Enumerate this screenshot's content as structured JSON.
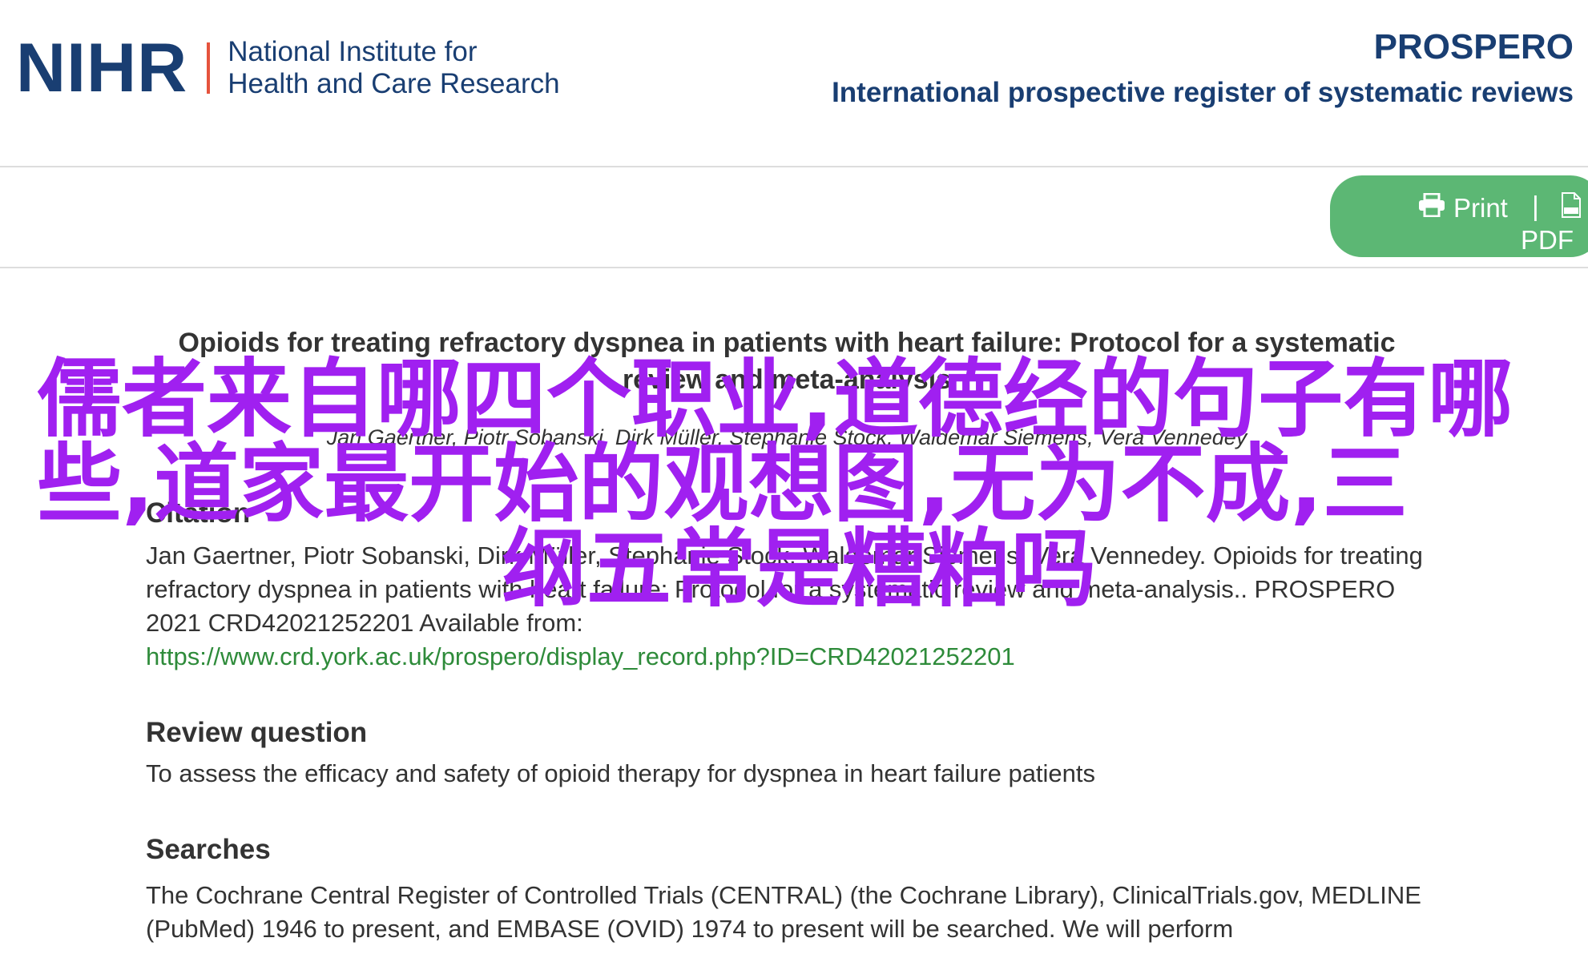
{
  "header": {
    "org_mark": "NIHR",
    "org_line1": "National Institute for",
    "org_line2": "Health and Care Research",
    "site_title": "PROSPERO",
    "site_subtitle": "International prospective register of systematic reviews"
  },
  "toolbar": {
    "print_label": "Print",
    "separator": "|",
    "pdf_label": "PDF",
    "pill_color": "#5cb774"
  },
  "record": {
    "title_line1": "Opioids for treating refractory dyspnea in patients with heart failure: Protocol for a systematic",
    "title_line2": "review and meta-analysis",
    "authors": "Jan Gaertner, Piotr Sobanski, Dirk Müller, Stephanie Stock, Waldemar Siemens, Vera Vennedey",
    "citation_heading": "Citation",
    "citation_text": "Jan Gaertner, Piotr Sobanski, Dirk Müller, Stephanie Stock, Waldemar Siemens, Vera Vennedey. Opioids for treating refractory dyspnea in patients with heart failure: Protocol for a systematic review and meta-analysis.. PROSPERO 2021 CRD42021252201 Available from:",
    "citation_link": "https://www.crd.york.ac.uk/prospero/display_record.php?ID=CRD42021252201",
    "review_question_heading": "Review question",
    "review_question_text": "To assess the efficacy and safety of opioid therapy for dyspnea in heart failure patients",
    "searches_heading": "Searches",
    "searches_text": "The Cochrane Central Register of Controlled Trials (CENTRAL) (the Cochrane Library), ClinicalTrials.gov, MEDLINE (PubMed) 1946 to present, and EMBASE (OVID) 1974 to present will be searched. We will perform"
  },
  "overlay": {
    "line1": "儒者来自哪四个职业,道德经的句子有哪",
    "line2": "些,道家最开始的观想图,无为不成,三",
    "line3": "纲五常是糟粕吗",
    "color": "#a020f0"
  },
  "colors": {
    "brand_navy": "#193e72",
    "brand_accent": "#e5533d",
    "link_green": "#2e8b3a"
  }
}
